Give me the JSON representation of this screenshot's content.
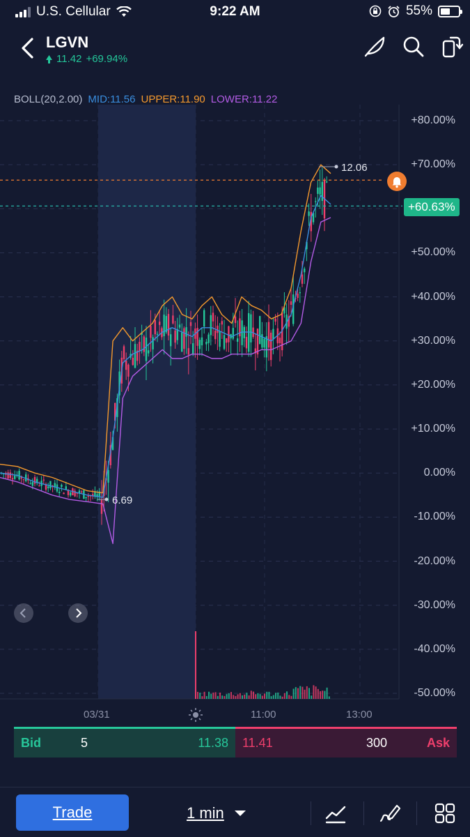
{
  "status_bar": {
    "carrier": "U.S. Cellular",
    "time": "9:22 AM",
    "battery": "55%"
  },
  "header": {
    "ticker": "LGVN",
    "price": "11.42",
    "change": "+69.94%"
  },
  "indicator": {
    "name": "BOLL(20,2.00)",
    "mid": "MID:11.56",
    "upper": "UPPER:11.90",
    "lower": "LOWER:11.22"
  },
  "chart": {
    "y_labels": [
      "+80.00%",
      "+70.00%",
      "+60.00%",
      "+50.00%",
      "+40.00%",
      "+30.00%",
      "+20.00%",
      "+10.00%",
      "0.00%",
      "-10.00%",
      "-20.00%",
      "-30.00%",
      "-40.00%",
      "-50.00%"
    ],
    "x_labels": [
      "03/31",
      "11:00",
      "13:00"
    ],
    "high_label": "12.06",
    "low_label": "6.69",
    "current_label": "+60.63%"
  },
  "chart_data": {
    "type": "line",
    "title": "",
    "ylim": [
      -50,
      80
    ],
    "y_unit": "%",
    "alert_level": 66.5,
    "current_level": 60.63,
    "series": [
      {
        "color": "#f5992d",
        "values": [
          2,
          1.5,
          0,
          -1,
          -2.5,
          -4,
          -4.5,
          30,
          33,
          30,
          32,
          34,
          38,
          40,
          36,
          35,
          38,
          40,
          36,
          34,
          40,
          38,
          37,
          35,
          36,
          42,
          55,
          66,
          70,
          68
        ]
      },
      {
        "color": "#3a8fe0",
        "values": [
          0,
          -0.5,
          -2,
          -3,
          -4,
          -5,
          -5.5,
          8,
          25,
          27,
          28,
          30,
          32,
          33,
          32,
          31,
          33,
          33,
          32,
          31,
          32,
          32,
          31,
          30,
          32,
          36,
          45,
          58,
          63,
          61
        ]
      },
      {
        "color": "#b45ce6",
        "values": [
          -1,
          -2,
          -3.5,
          -5,
          -6,
          -6.5,
          -7,
          -16,
          17,
          22,
          24,
          26,
          28,
          26,
          26,
          27,
          27,
          26,
          26,
          27,
          27,
          27,
          28,
          28,
          29,
          30,
          34,
          48,
          57,
          58
        ]
      }
    ]
  },
  "bidask": {
    "bid_label": "Bid",
    "bid_size": "5",
    "bid_price": "11.38",
    "ask_price": "11.41",
    "ask_size": "300",
    "ask_label": "Ask"
  },
  "toolbar": {
    "trade": "Trade",
    "interval": "1 min"
  },
  "colors": {
    "up": "#24c79a",
    "down": "#ee3f6c",
    "mid": "#3a8fe0",
    "upper": "#f5992d",
    "lower": "#b45ce6",
    "background": "#141a30"
  },
  "icons": [
    "back-arrow-icon",
    "feather-icon",
    "search-icon",
    "rotate-icon",
    "bell-icon",
    "indicator-icon",
    "draw-icon",
    "grid-icon"
  ]
}
